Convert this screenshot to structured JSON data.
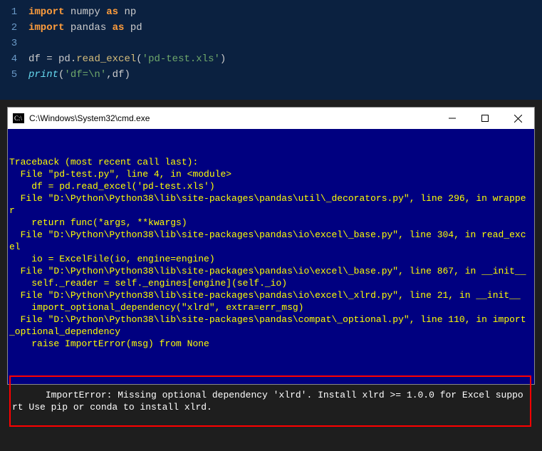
{
  "editor": {
    "lines": [
      {
        "num": "1",
        "tokens": [
          {
            "cls": "kw",
            "t": "import"
          },
          {
            "cls": "pn",
            "t": " "
          },
          {
            "cls": "id",
            "t": "numpy"
          },
          {
            "cls": "pn",
            "t": " "
          },
          {
            "cls": "kw",
            "t": "as"
          },
          {
            "cls": "pn",
            "t": " "
          },
          {
            "cls": "id",
            "t": "np"
          }
        ]
      },
      {
        "num": "2",
        "tokens": [
          {
            "cls": "kw",
            "t": "import"
          },
          {
            "cls": "pn",
            "t": " "
          },
          {
            "cls": "id",
            "t": "pandas"
          },
          {
            "cls": "pn",
            "t": " "
          },
          {
            "cls": "kw",
            "t": "as"
          },
          {
            "cls": "pn",
            "t": " "
          },
          {
            "cls": "id",
            "t": "pd"
          }
        ]
      },
      {
        "num": "3",
        "tokens": []
      },
      {
        "num": "4",
        "tokens": [
          {
            "cls": "id",
            "t": "df"
          },
          {
            "cls": "pn",
            "t": " = "
          },
          {
            "cls": "id",
            "t": "pd"
          },
          {
            "cls": "pn",
            "t": "."
          },
          {
            "cls": "fn",
            "t": "read_excel"
          },
          {
            "cls": "pn",
            "t": "("
          },
          {
            "cls": "str",
            "t": "'pd-test.xls'"
          },
          {
            "cls": "pn",
            "t": ")"
          }
        ]
      },
      {
        "num": "5",
        "tokens": [
          {
            "cls": "builtin",
            "t": "print"
          },
          {
            "cls": "pn",
            "t": "("
          },
          {
            "cls": "str",
            "t": "'df=\\n'"
          },
          {
            "cls": "pn",
            "t": ","
          },
          {
            "cls": "id",
            "t": "df"
          },
          {
            "cls": "pn",
            "t": ")"
          }
        ]
      }
    ]
  },
  "terminal": {
    "title": "C:\\Windows\\System32\\cmd.exe",
    "traceback": [
      "Traceback (most recent call last):",
      "  File \"pd-test.py\", line 4, in <module>",
      "    df = pd.read_excel('pd-test.xls')",
      "  File \"D:\\Python\\Python38\\lib\\site-packages\\pandas\\util\\_decorators.py\", line 296, in wrapper",
      "    return func(*args, **kwargs)",
      "  File \"D:\\Python\\Python38\\lib\\site-packages\\pandas\\io\\excel\\_base.py\", line 304, in read_excel",
      "    io = ExcelFile(io, engine=engine)",
      "  File \"D:\\Python\\Python38\\lib\\site-packages\\pandas\\io\\excel\\_base.py\", line 867, in __init__",
      "    self._reader = self._engines[engine](self._io)",
      "  File \"D:\\Python\\Python38\\lib\\site-packages\\pandas\\io\\excel\\_xlrd.py\", line 21, in __init__",
      "    import_optional_dependency(\"xlrd\", extra=err_msg)",
      "  File \"D:\\Python\\Python38\\lib\\site-packages\\pandas\\compat\\_optional.py\", line 110, in import_optional_dependency",
      "    raise ImportError(msg) from None"
    ],
    "error": "ImportError: Missing optional dependency 'xlrd'. Install xlrd >= 1.0.0 for Excel support Use pip or conda to install xlrd."
  }
}
